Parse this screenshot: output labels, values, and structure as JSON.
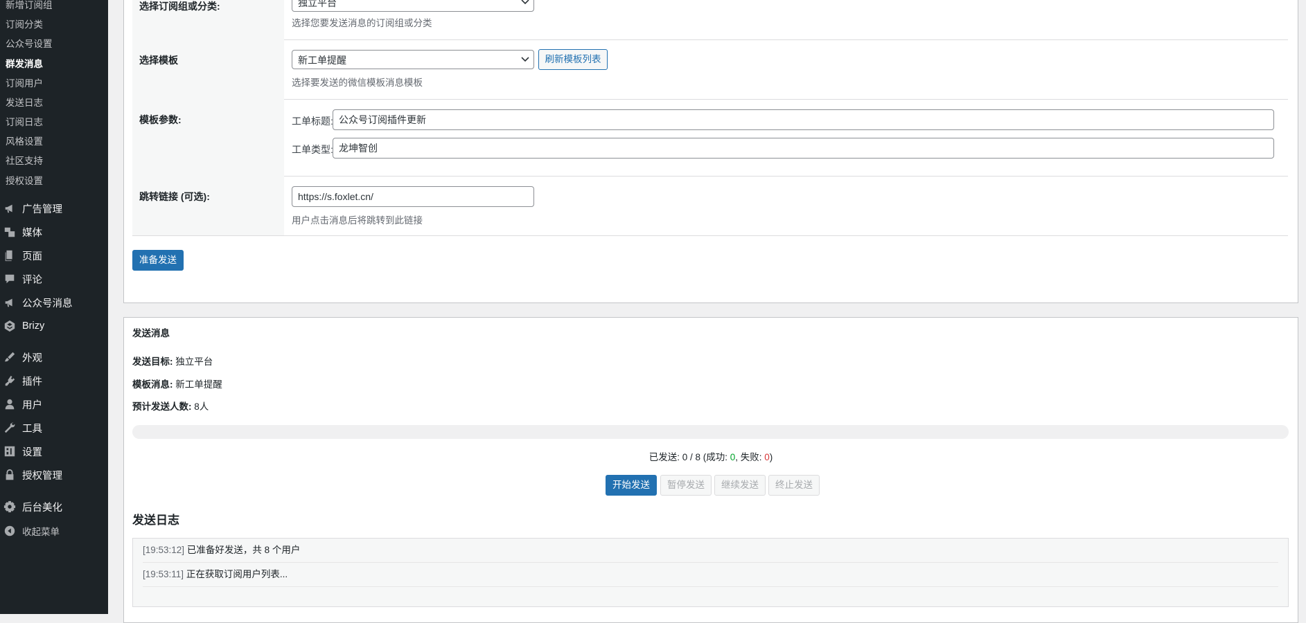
{
  "sidebar": {
    "submenu": [
      {
        "label": "新增订阅组"
      },
      {
        "label": "订阅分类"
      },
      {
        "label": "公众号设置"
      },
      {
        "label": "群发消息"
      },
      {
        "label": "订阅用户"
      },
      {
        "label": "发送日志"
      },
      {
        "label": "订阅日志"
      },
      {
        "label": "风格设置"
      },
      {
        "label": "社区支持"
      },
      {
        "label": "授权设置"
      }
    ],
    "menu": [
      {
        "label": "广告管理",
        "icon": "megaphone-icon"
      },
      {
        "label": "媒体",
        "icon": "media-icon"
      },
      {
        "label": "页面",
        "icon": "page-icon"
      },
      {
        "label": "评论",
        "icon": "comment-icon"
      },
      {
        "label": "公众号消息",
        "icon": "megaphone-icon"
      },
      {
        "label": "Brizy",
        "icon": "brizy-icon"
      },
      {
        "label": "外观",
        "icon": "brush-icon"
      },
      {
        "label": "插件",
        "icon": "plugin-icon"
      },
      {
        "label": "用户",
        "icon": "user-icon"
      },
      {
        "label": "工具",
        "icon": "wrench-icon"
      },
      {
        "label": "设置",
        "icon": "settings-icon"
      },
      {
        "label": "授权管理",
        "icon": "lock-icon"
      },
      {
        "label": "后台美化",
        "icon": "gear-icon"
      },
      {
        "label": "收起菜单",
        "icon": "collapse-icon"
      }
    ]
  },
  "form": {
    "group_row": {
      "label": "选择订阅组或分类:",
      "select_value": "独立平台",
      "description": "选择您要发送消息的订阅组或分类"
    },
    "template_row": {
      "label": "选择模板",
      "select_value": "新工单提醒",
      "refresh_button": "刷新模板列表",
      "description": "选择要发送的微信模板消息模板"
    },
    "params_row": {
      "label": "模板参数:",
      "field1_label": "工单标题:",
      "field1_value": "公众号订阅插件更新",
      "field2_label": "工单类型:",
      "field2_value": "龙坤智创"
    },
    "link_row": {
      "label": "跳转链接 (可选):",
      "value": "https://s.foxlet.cn/",
      "description": "用户点击消息后将跳转到此链接"
    },
    "prepare_button": "准备发送"
  },
  "send_panel": {
    "title": "发送消息",
    "target_label": "发送目标:",
    "target_value": "独立平台",
    "template_label": "模板消息:",
    "template_value": "新工单提醒",
    "count_label": "预计发送人数:",
    "count_value": "8人",
    "progress": 0,
    "counter": {
      "prefix": "已发送: 0 / 8 (成功: ",
      "success": "0",
      "middle": ", 失败: ",
      "fail": "0",
      "suffix": ")"
    },
    "buttons": {
      "start": "开始发送",
      "pause": "暂停发送",
      "resume": "继续发送",
      "stop": "终止发送"
    },
    "log_title": "发送日志",
    "log": [
      {
        "time": "[19:53:12]",
        "text": "已准备好发送，共 8 个用户"
      },
      {
        "time": "[19:53:11]",
        "text": "正在获取订阅用户列表..."
      }
    ]
  },
  "colors": {
    "sidebar_bg": "#1d2327",
    "primary": "#2271b1",
    "success": "#00a32a",
    "error": "#d63638"
  }
}
